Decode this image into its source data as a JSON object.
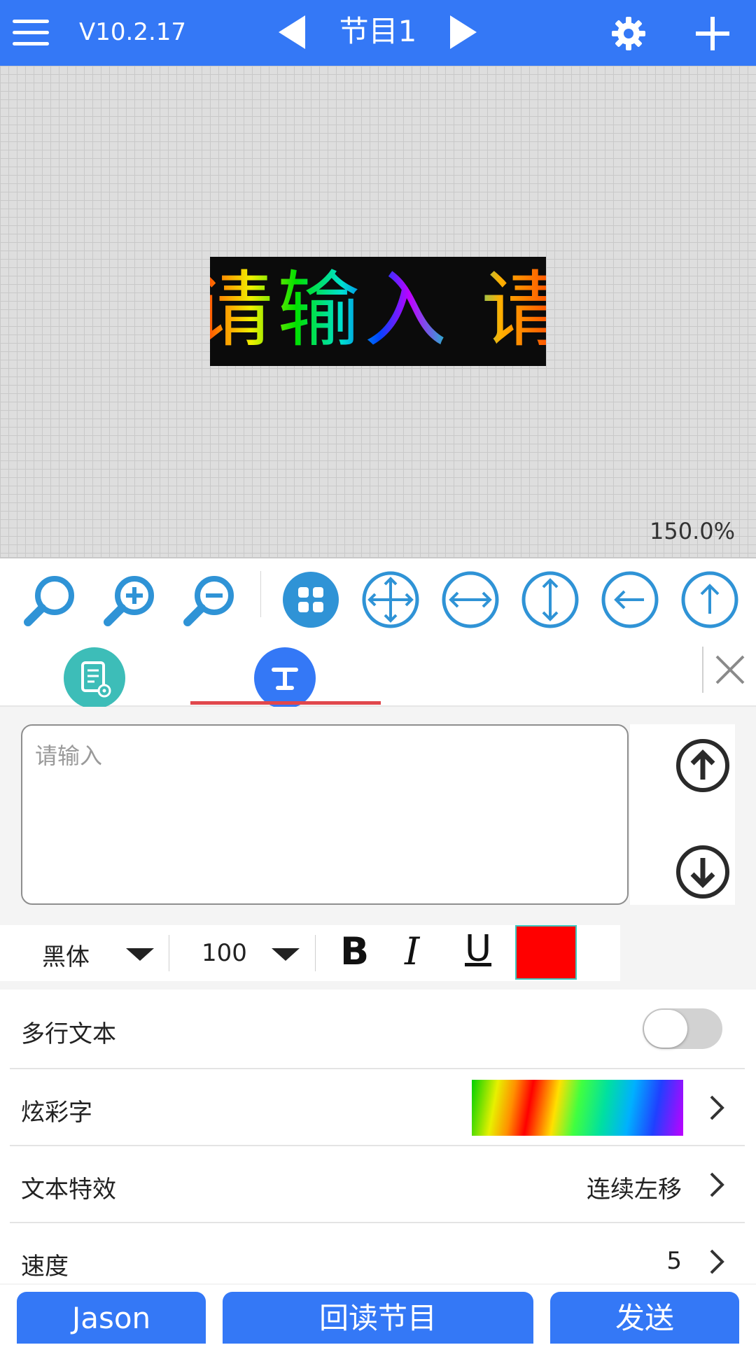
{
  "header": {
    "version": "V10.2.17",
    "program_title": "节目1"
  },
  "canvas": {
    "led_text": "请输入 请",
    "zoom_level": "150.0%"
  },
  "editor": {
    "text_placeholder": "请输入",
    "font_name": "黑体",
    "font_size": "100",
    "bold_label": "B",
    "italic_label": "I",
    "underline_label": "U",
    "text_color": "#ff0000"
  },
  "settings": {
    "multiline_label": "多行文本",
    "multiline_on": false,
    "colorful_label": "炫彩字",
    "effect_label": "文本特效",
    "effect_value": "连续左移",
    "speed_label": "速度",
    "speed_value": "5"
  },
  "bottom_buttons": {
    "user": "Jason",
    "readback": "回读节目",
    "send": "发送"
  },
  "icons": [
    "menu-icon",
    "gear-icon",
    "plus-icon",
    "zoom-fit-icon",
    "zoom-in-icon",
    "zoom-out-icon",
    "grid-icon",
    "move-all-icon",
    "move-horizontal-icon",
    "move-vertical-icon",
    "arrow-left-icon",
    "arrow-up-icon",
    "properties-icon",
    "text-icon",
    "close-icon",
    "arrow-up-circle-icon",
    "arrow-down-circle-icon",
    "chevron-right-icon"
  ],
  "colors": {
    "primary": "#3478f6",
    "tool_icon": "#2f93d6",
    "tab_active_underline": "#e0474c",
    "props_tab": "#3dbdb8"
  }
}
